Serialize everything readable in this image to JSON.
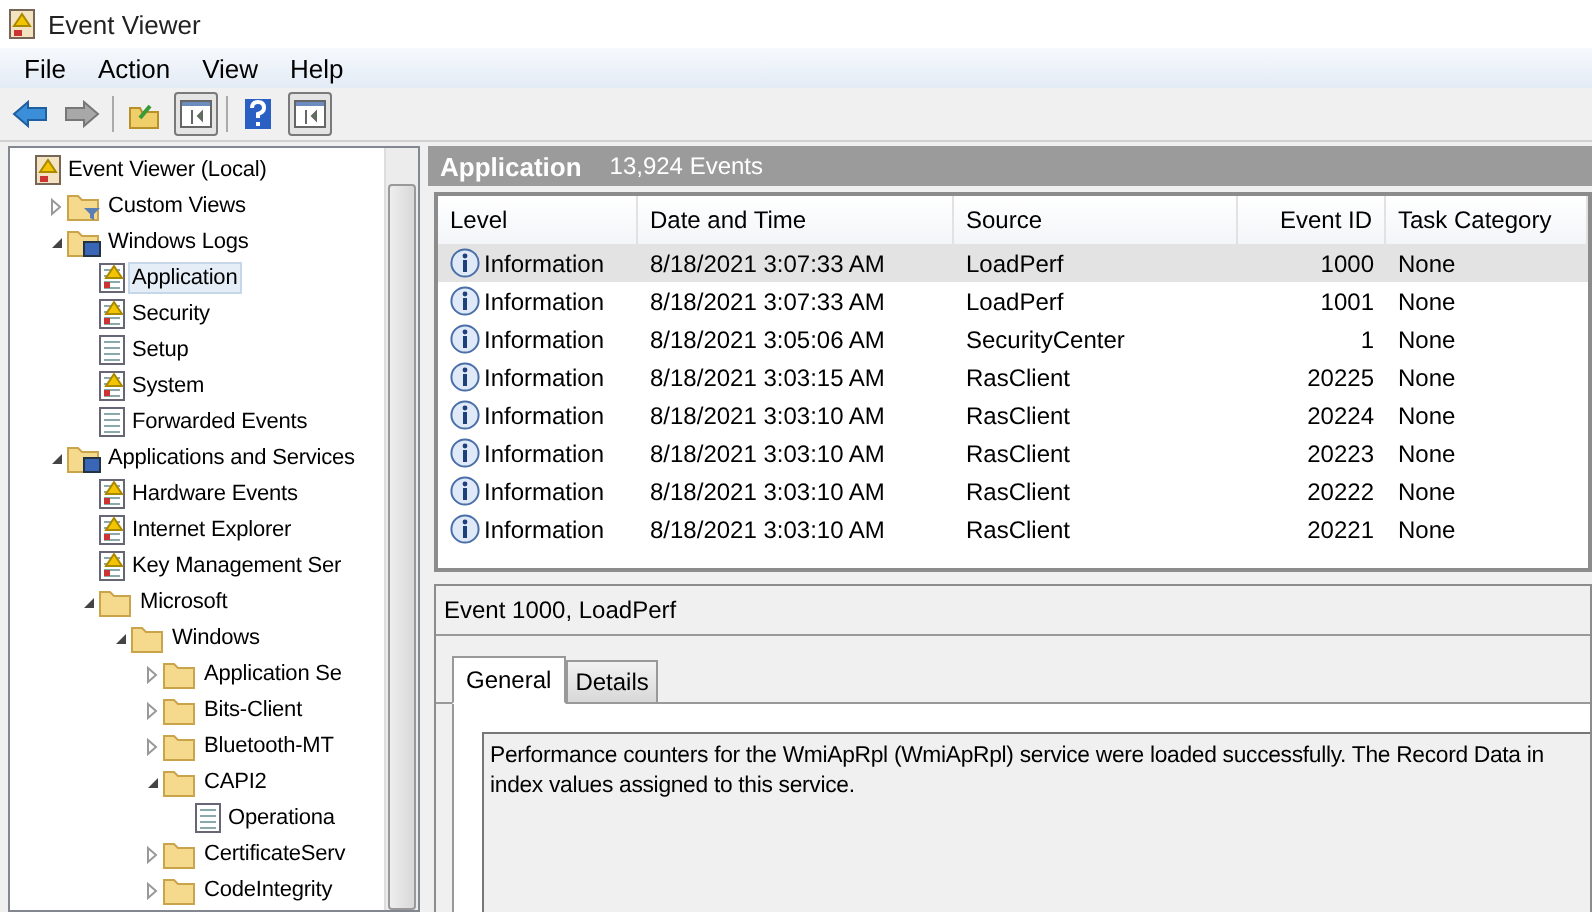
{
  "window": {
    "title": "Event Viewer"
  },
  "menu": [
    "File",
    "Action",
    "View",
    "Help"
  ],
  "toolbar": [
    {
      "kind": "back"
    },
    {
      "kind": "forward"
    },
    {
      "kind": "open"
    },
    {
      "kind": "pane",
      "on": true
    },
    {
      "kind": "help"
    },
    {
      "kind": "pane",
      "on": true
    }
  ],
  "tree": [
    {
      "label": "Event Viewer (Local)",
      "kind": "root",
      "selected": false,
      "children": [
        {
          "label": "Custom Views",
          "kind": "filter-folder",
          "expanded": false,
          "selected": false
        },
        {
          "label": "Windows Logs",
          "kind": "logs-folder",
          "expanded": true,
          "selected": false,
          "children": [
            {
              "label": "Application",
              "kind": "event-log",
              "selected": true
            },
            {
              "label": "Security",
              "kind": "event-log",
              "selected": false
            },
            {
              "label": "Setup",
              "kind": "plain-log",
              "selected": false
            },
            {
              "label": "System",
              "kind": "event-log",
              "selected": false
            },
            {
              "label": "Forwarded Events",
              "kind": "plain-log",
              "selected": false
            }
          ]
        },
        {
          "label": "Applications and Services",
          "kind": "logs-folder",
          "expanded": true,
          "selected": false,
          "children": [
            {
              "label": "Hardware Events",
              "kind": "event-log",
              "selected": false
            },
            {
              "label": "Internet Explorer",
              "kind": "event-log",
              "selected": false
            },
            {
              "label": "Key Management Ser",
              "kind": "event-log",
              "selected": false
            },
            {
              "label": "Microsoft",
              "kind": "folder",
              "expanded": true,
              "selected": false,
              "children": [
                {
                  "label": "Windows",
                  "kind": "folder",
                  "expanded": true,
                  "selected": false,
                  "children": [
                    {
                      "label": "Application Se",
                      "kind": "folder",
                      "expanded": false,
                      "selected": false
                    },
                    {
                      "label": "Bits-Client",
                      "kind": "folder",
                      "expanded": false,
                      "selected": false
                    },
                    {
                      "label": "Bluetooth-MT",
                      "kind": "folder",
                      "expanded": false,
                      "selected": false
                    },
                    {
                      "label": "CAPI2",
                      "kind": "folder",
                      "expanded": true,
                      "selected": false,
                      "children": [
                        {
                          "label": "Operationa",
                          "kind": "plain-log",
                          "selected": false
                        }
                      ]
                    },
                    {
                      "label": "CertificateServ",
                      "kind": "folder",
                      "expanded": false,
                      "selected": false
                    },
                    {
                      "label": "CodeIntegrity",
                      "kind": "folder",
                      "expanded": false,
                      "selected": false
                    }
                  ]
                }
              ]
            }
          ]
        }
      ]
    }
  ],
  "events_header": {
    "title": "Application",
    "count": "13,924 Events"
  },
  "table": {
    "columns": [
      "Level",
      "Date and Time",
      "Source",
      "Event ID",
      "Task Category"
    ],
    "rows": [
      {
        "level": "Information",
        "date": "8/18/2021 3:07:33 AM",
        "source": "LoadPerf",
        "event_id": "1000",
        "task": "None",
        "selected": true
      },
      {
        "level": "Information",
        "date": "8/18/2021 3:07:33 AM",
        "source": "LoadPerf",
        "event_id": "1001",
        "task": "None",
        "selected": false
      },
      {
        "level": "Information",
        "date": "8/18/2021 3:05:06 AM",
        "source": "SecurityCenter",
        "event_id": "1",
        "task": "None",
        "selected": false
      },
      {
        "level": "Information",
        "date": "8/18/2021 3:03:15 AM",
        "source": "RasClient",
        "event_id": "20225",
        "task": "None",
        "selected": false
      },
      {
        "level": "Information",
        "date": "8/18/2021 3:03:10 AM",
        "source": "RasClient",
        "event_id": "20224",
        "task": "None",
        "selected": false
      },
      {
        "level": "Information",
        "date": "8/18/2021 3:03:10 AM",
        "source": "RasClient",
        "event_id": "20223",
        "task": "None",
        "selected": false
      },
      {
        "level": "Information",
        "date": "8/18/2021 3:03:10 AM",
        "source": "RasClient",
        "event_id": "20222",
        "task": "None",
        "selected": false
      },
      {
        "level": "Information",
        "date": "8/18/2021 3:03:10 AM",
        "source": "RasClient",
        "event_id": "20221",
        "task": "None",
        "selected": false
      }
    ]
  },
  "detail": {
    "title": "Event 1000, LoadPerf",
    "tabs": [
      {
        "label": "General",
        "selected": true
      },
      {
        "label": "Details",
        "selected": false
      }
    ],
    "message": "Performance counters for the WmiApRpl (WmiApRpl) service were loaded successfully. The Record Data in\nindex values assigned to this service."
  }
}
